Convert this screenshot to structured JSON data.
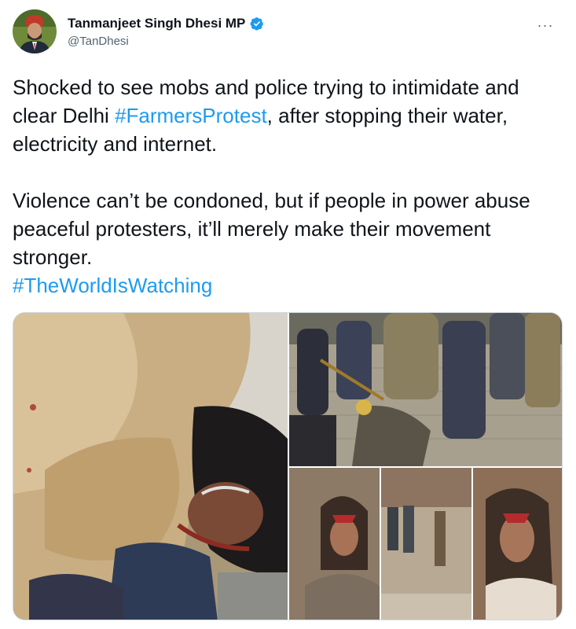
{
  "tweet": {
    "author": {
      "name": "Tanmanjeet Singh Dhesi MP",
      "handle": "@TanDhesi",
      "verified": true,
      "verified_icon": "verified-badge-icon"
    },
    "more_icon": "more-horizontal-icon",
    "more_label": "···",
    "text": {
      "p1_before": "Shocked to see mobs and police trying to intimidate and clear Delhi ",
      "p1_hashtag": "#FarmersProtest",
      "p1_after": ", after stopping their water, electricity and internet.",
      "p2": "Violence can’t be condoned, but if people in power abuse peaceful protesters, it’ll merely make their movement stronger.",
      "p3_hashtag": "#TheWorldIsWatching"
    },
    "media": {
      "count": 3,
      "items": [
        {
          "name": "photo-protester-pinned-to-ground"
        },
        {
          "name": "photo-police-beating-protesters"
        },
        {
          "name": "photo-collage-injured-protester"
        }
      ]
    },
    "colors": {
      "link": "#1d9bf0",
      "text": "#0f1419",
      "secondary": "#536471",
      "verified": "#1d9bf0"
    }
  }
}
